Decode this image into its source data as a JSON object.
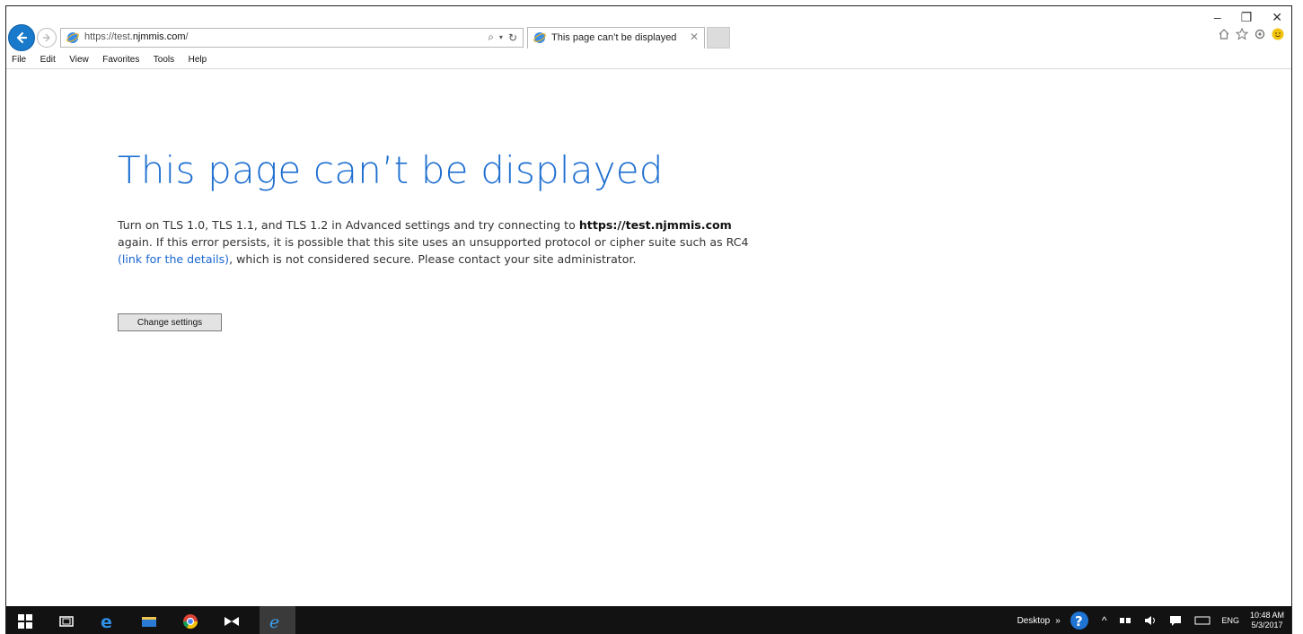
{
  "browser": {
    "address_url_prefix": "https://test.",
    "address_url_domain": "njmmis.com",
    "address_url_suffix": "/",
    "tab_title": "This page can’t be displayed",
    "menu": [
      "File",
      "Edit",
      "View",
      "Favorites",
      "Tools",
      "Help"
    ]
  },
  "page": {
    "heading": "This page can’t be displayed",
    "message_part1": "Turn on TLS 1.0, TLS 1.1, and TLS 1.2 in Advanced settings and try connecting to ",
    "message_host": "https://test.njmmis.com",
    "message_part2": " again. If this error persists, it is possible that this site uses an unsupported protocol or cipher suite such as RC4 ",
    "message_link": "(link for the details)",
    "message_part3": ", which is not considered secure. Please contact your site administrator.",
    "button_label": "Change settings"
  },
  "taskbar": {
    "desktop_label": "Desktop",
    "language": "ENG",
    "time": "10:48 AM",
    "date": "5/3/2017"
  },
  "colors": {
    "heading": "#1e6fd0",
    "link": "#1b67cf",
    "taskbar": "#121212"
  }
}
